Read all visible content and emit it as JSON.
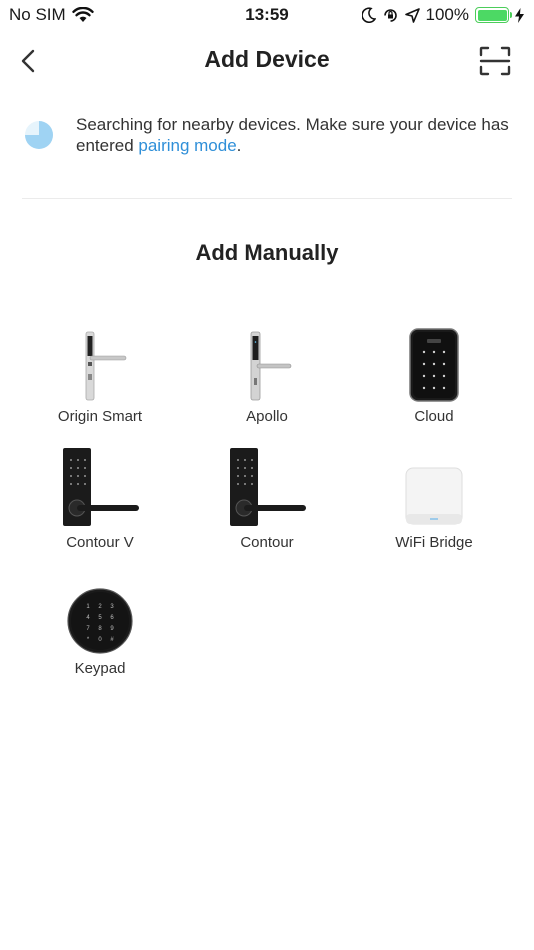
{
  "status_bar": {
    "carrier": "No SIM",
    "time": "13:59",
    "battery": "100%",
    "icons": [
      "wifi-icon",
      "moon-icon",
      "rotation-lock-icon",
      "location-arrow-icon",
      "battery-icon",
      "charging-bolt-icon"
    ]
  },
  "nav": {
    "title": "Add Device",
    "back_icon": "chevron-left-icon",
    "scan_icon": "scan-icon"
  },
  "search": {
    "text_before": "Searching for nearby devices. Make sure your device has entered ",
    "link": "pairing mode",
    "text_after": "."
  },
  "manual": {
    "title": "Add Manually",
    "devices": [
      {
        "label": "Origin Smart",
        "icon": "origin-smart-lock-image"
      },
      {
        "label": "Apollo",
        "icon": "apollo-lock-image"
      },
      {
        "label": "Cloud",
        "icon": "cloud-keypad-image"
      },
      {
        "label": "Contour V",
        "icon": "contour-v-lock-image"
      },
      {
        "label": "Contour",
        "icon": "contour-lock-image"
      },
      {
        "label": "WiFi Bridge",
        "icon": "wifi-bridge-image"
      },
      {
        "label": "Keypad",
        "icon": "keypad-image"
      }
    ]
  },
  "colors": {
    "link": "#2f8fd8",
    "battery": "#4cd964",
    "spinner": "#9fd3f3"
  }
}
